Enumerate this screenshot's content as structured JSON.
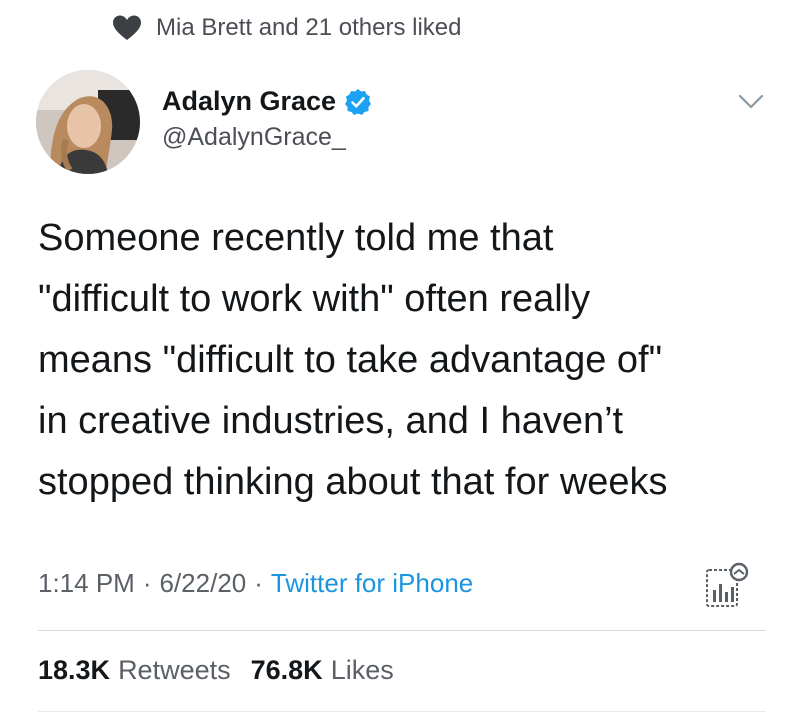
{
  "social_context": {
    "icon": "heart-icon",
    "text": "Mia Brett and 21 others liked"
  },
  "author": {
    "avatar": "avatar",
    "name": "Adalyn Grace",
    "verified_icon": "verified-icon",
    "handle": "@AdalynGrace_"
  },
  "tweet": {
    "text": "Someone recently told me that\n\"difficult to work with\" often really\nmeans \"difficult to take advantage of\"\nin creative industries, and I haven’t\nstopped thinking about that for weeks"
  },
  "meta": {
    "time": "1:14 PM",
    "separator": "·",
    "date": "6/22/20",
    "source": "Twitter for iPhone",
    "analytics_icon": "analytics-icon"
  },
  "stats": {
    "retweets_count": "18.3K",
    "retweets_label": "Retweets",
    "likes_count": "76.8K",
    "likes_label": "Likes"
  },
  "colors": {
    "link": "#1b95e0",
    "verified": "#1da1f2",
    "secondary_text": "#5b6066"
  }
}
